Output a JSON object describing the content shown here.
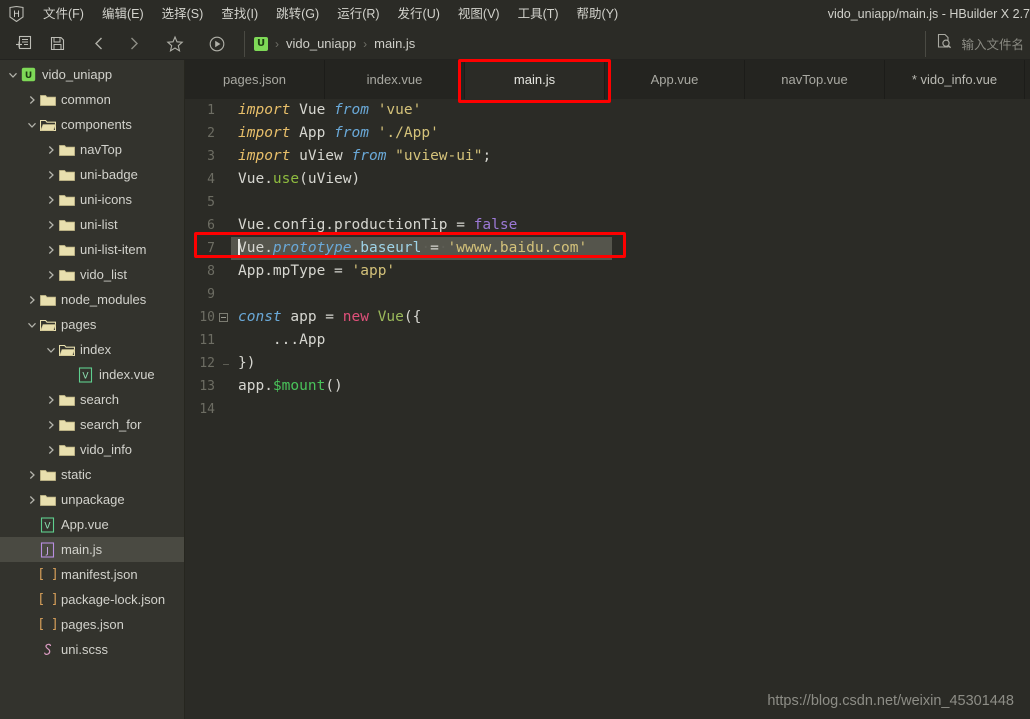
{
  "window": {
    "title": "vido_uniapp/main.js - HBuilder X 2.7",
    "logo_letter": "H"
  },
  "menubar": {
    "items": [
      {
        "label": "文件(F)",
        "name": "menu-file"
      },
      {
        "label": "编辑(E)",
        "name": "menu-edit"
      },
      {
        "label": "选择(S)",
        "name": "menu-select"
      },
      {
        "label": "查找(I)",
        "name": "menu-find"
      },
      {
        "label": "跳转(G)",
        "name": "menu-goto"
      },
      {
        "label": "运行(R)",
        "name": "menu-run"
      },
      {
        "label": "发行(U)",
        "name": "menu-publish"
      },
      {
        "label": "视图(V)",
        "name": "menu-view"
      },
      {
        "label": "工具(T)",
        "name": "menu-tools"
      },
      {
        "label": "帮助(Y)",
        "name": "menu-help"
      }
    ]
  },
  "toolbar": {
    "icons": [
      "new-file-icon",
      "save-icon",
      "back-icon",
      "forward-icon",
      "star-icon",
      "run-icon"
    ],
    "breadcrumb": {
      "project_icon_letter": "U",
      "project": "vido_uniapp",
      "file": "main.js",
      "separator": "›"
    },
    "search_file_icon": "file-search-icon",
    "filename_placeholder": "输入文件名"
  },
  "sidebar": {
    "items": [
      {
        "label": "vido_uniapp",
        "depth": 0,
        "twisty": "down",
        "icon": "uniapp-project-icon",
        "selected": false
      },
      {
        "label": "common",
        "depth": 1,
        "twisty": "right",
        "icon": "folder-icon",
        "selected": false
      },
      {
        "label": "components",
        "depth": 1,
        "twisty": "down",
        "icon": "folder-open-icon",
        "selected": false
      },
      {
        "label": "navTop",
        "depth": 2,
        "twisty": "right",
        "icon": "folder-icon",
        "selected": false
      },
      {
        "label": "uni-badge",
        "depth": 2,
        "twisty": "right",
        "icon": "folder-icon",
        "selected": false
      },
      {
        "label": "uni-icons",
        "depth": 2,
        "twisty": "right",
        "icon": "folder-icon",
        "selected": false
      },
      {
        "label": "uni-list",
        "depth": 2,
        "twisty": "right",
        "icon": "folder-icon",
        "selected": false
      },
      {
        "label": "uni-list-item",
        "depth": 2,
        "twisty": "right",
        "icon": "folder-icon",
        "selected": false
      },
      {
        "label": "vido_list",
        "depth": 2,
        "twisty": "right",
        "icon": "folder-icon",
        "selected": false
      },
      {
        "label": "node_modules",
        "depth": 1,
        "twisty": "right",
        "icon": "folder-icon",
        "selected": false
      },
      {
        "label": "pages",
        "depth": 1,
        "twisty": "down",
        "icon": "folder-open-icon",
        "selected": false
      },
      {
        "label": "index",
        "depth": 2,
        "twisty": "down",
        "icon": "folder-open-icon",
        "selected": false
      },
      {
        "label": "index.vue",
        "depth": 3,
        "twisty": "none",
        "icon": "vue-file-icon",
        "selected": false
      },
      {
        "label": "search",
        "depth": 2,
        "twisty": "right",
        "icon": "folder-icon",
        "selected": false
      },
      {
        "label": "search_for",
        "depth": 2,
        "twisty": "right",
        "icon": "folder-icon",
        "selected": false
      },
      {
        "label": "vido_info",
        "depth": 2,
        "twisty": "right",
        "icon": "folder-icon",
        "selected": false
      },
      {
        "label": "static",
        "depth": 1,
        "twisty": "right",
        "icon": "folder-icon",
        "selected": false
      },
      {
        "label": "unpackage",
        "depth": 1,
        "twisty": "right",
        "icon": "folder-icon",
        "selected": false
      },
      {
        "label": "App.vue",
        "depth": 1,
        "twisty": "none",
        "icon": "vue-file-icon",
        "selected": false
      },
      {
        "label": "main.js",
        "depth": 1,
        "twisty": "none",
        "icon": "js-file-icon",
        "selected": true
      },
      {
        "label": "manifest.json",
        "depth": 1,
        "twisty": "none",
        "icon": "json-file-icon",
        "selected": false
      },
      {
        "label": "package-lock.json",
        "depth": 1,
        "twisty": "none",
        "icon": "json-file-icon",
        "selected": false
      },
      {
        "label": "pages.json",
        "depth": 1,
        "twisty": "none",
        "icon": "json-file-icon",
        "selected": false
      },
      {
        "label": "uni.scss",
        "depth": 1,
        "twisty": "none",
        "icon": "scss-file-icon",
        "selected": false
      }
    ]
  },
  "tabs": [
    {
      "label": "pages.json",
      "active": false,
      "modified": false
    },
    {
      "label": "index.vue",
      "active": false,
      "modified": false
    },
    {
      "label": "main.js",
      "active": true,
      "modified": false
    },
    {
      "label": "App.vue",
      "active": false,
      "modified": false
    },
    {
      "label": "navTop.vue",
      "active": false,
      "modified": false
    },
    {
      "label": "* vido_info.vue",
      "active": false,
      "modified": true
    }
  ],
  "editor": {
    "file": "main.js",
    "selected_line": 7,
    "selected_text": "Vue.prototype.baseurl = 'wwww.baidu.com'",
    "lines": [
      {
        "n": 1,
        "text": "import Vue from 'vue'"
      },
      {
        "n": 2,
        "text": "import App from './App'"
      },
      {
        "n": 3,
        "text": "import uView from \"uview-ui\";"
      },
      {
        "n": 4,
        "text": "Vue.use(uView)"
      },
      {
        "n": 5,
        "text": ""
      },
      {
        "n": 6,
        "text": "Vue.config.productionTip = false"
      },
      {
        "n": 7,
        "text": "Vue.prototype.baseurl = 'wwww.baidu.com'"
      },
      {
        "n": 8,
        "text": "App.mpType = 'app'"
      },
      {
        "n": 9,
        "text": ""
      },
      {
        "n": 10,
        "text": "const app = new Vue({"
      },
      {
        "n": 11,
        "text": "    ...App"
      },
      {
        "n": 12,
        "text": "})"
      },
      {
        "n": 13,
        "text": "app.$mount()"
      },
      {
        "n": 14,
        "text": ""
      }
    ]
  },
  "annotations": {
    "tab_highlight": "main.js",
    "line_highlight": 7,
    "color": "#fe0000"
  },
  "watermark": "https://blog.csdn.net/weixin_45301448"
}
